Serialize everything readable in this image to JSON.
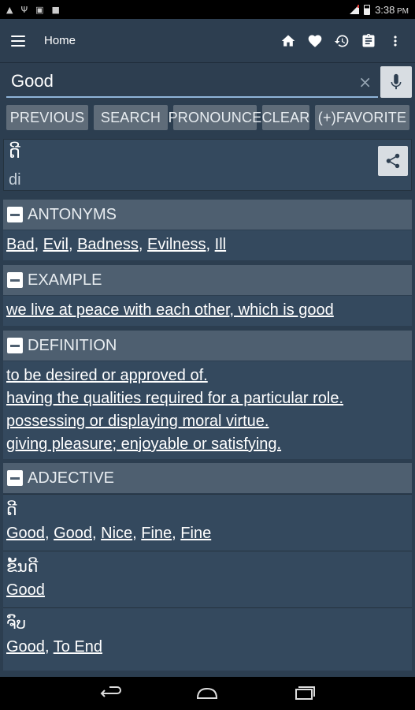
{
  "status_bar": {
    "time": "3:38",
    "time_suffix": "PM"
  },
  "app_bar": {
    "title": "Home",
    "actions": [
      "home-icon",
      "heart-icon",
      "history-icon",
      "clipboard-icon",
      "more-vert-icon"
    ]
  },
  "search": {
    "value": "Good",
    "placeholder": "",
    "clear_glyph": "×"
  },
  "buttons": {
    "previous": "PREVIOUS",
    "search": "SEARCH",
    "pronounce": "PRONOUNCE",
    "clear": "CLEAR",
    "favorite": "(+)FAVORITE"
  },
  "word": {
    "lao": "ດີ",
    "romanization": "di"
  },
  "sections": {
    "antonyms": {
      "title": "ANTONYMS",
      "items": [
        "Bad",
        "Evil",
        "Badness",
        "Evilness",
        "Ill"
      ]
    },
    "example": {
      "title": "EXAMPLE",
      "text": "we live at peace with each other, which is good"
    },
    "definition": {
      "title": "DEFINITION",
      "lines": [
        "to be desired or approved of.",
        "having the qualities required for a particular role.",
        "possessing or displaying moral virtue.",
        "giving pleasure; enjoyable or satisfying."
      ]
    },
    "adjective": {
      "title": "ADJECTIVE",
      "entries": [
        {
          "lao": "ດີ",
          "words": [
            "Good",
            "Good",
            "Nice",
            "Fine",
            "Fine"
          ]
        },
        {
          "lao": "ຂັ້ນດີ",
          "words": [
            "Good"
          ]
        },
        {
          "lao": "ຈົບ",
          "words": [
            "Good",
            "To End"
          ]
        }
      ]
    }
  }
}
